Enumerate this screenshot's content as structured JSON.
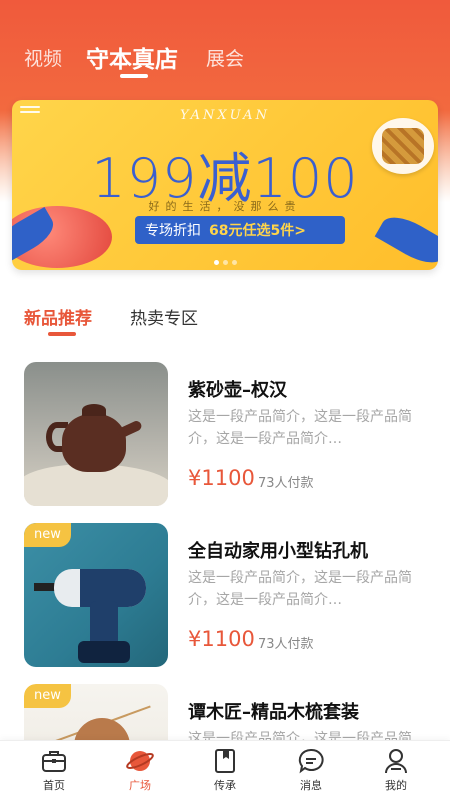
{
  "header": {
    "tabs": [
      {
        "label": "视频",
        "active": false
      },
      {
        "label": "守本真店",
        "active": true
      },
      {
        "label": "展会",
        "active": false
      }
    ]
  },
  "banner": {
    "brand": "YANXUAN",
    "headline": "199减100",
    "tagline": "好的生活，没那么贵",
    "cta_prefix": "专场折扣",
    "cta_highlight": "68元任选5件>",
    "page_count": 3,
    "active_page": 1
  },
  "section_tabs": [
    {
      "label": "新品推荐",
      "active": true
    },
    {
      "label": "热卖专区",
      "active": false
    }
  ],
  "products": [
    {
      "title": "紫砂壶–权汉",
      "desc": "这是一段产品简介，这是一段产品简介，这是一段产品简介…",
      "price": "¥1100",
      "paid": "73人付款",
      "badge": ""
    },
    {
      "title": "全自动家用小型钻孔机",
      "desc": "这是一段产品简介，这是一段产品简介，这是一段产品简介…",
      "price": "¥1100",
      "paid": "73人付款",
      "badge": "new"
    },
    {
      "title": "谭木匠–精品木梳套装",
      "desc": "这是一段产品简介，这是一段产品简介，这是一段产品简介…",
      "price": "",
      "paid": "",
      "badge": "new"
    }
  ],
  "bottom_nav": [
    {
      "label": "首页",
      "icon": "briefcase-icon",
      "active": false
    },
    {
      "label": "广场",
      "icon": "planet-icon",
      "active": true
    },
    {
      "label": "传承",
      "icon": "book-icon",
      "active": false
    },
    {
      "label": "消息",
      "icon": "chat-icon",
      "active": false
    },
    {
      "label": "我的",
      "icon": "user-icon",
      "active": false
    }
  ],
  "colors": {
    "accent": "#e8573a",
    "header": "#f05a3c",
    "banner_yellow": "#ffc93a",
    "banner_blue": "#2f61c8",
    "badge": "#f5c342"
  }
}
